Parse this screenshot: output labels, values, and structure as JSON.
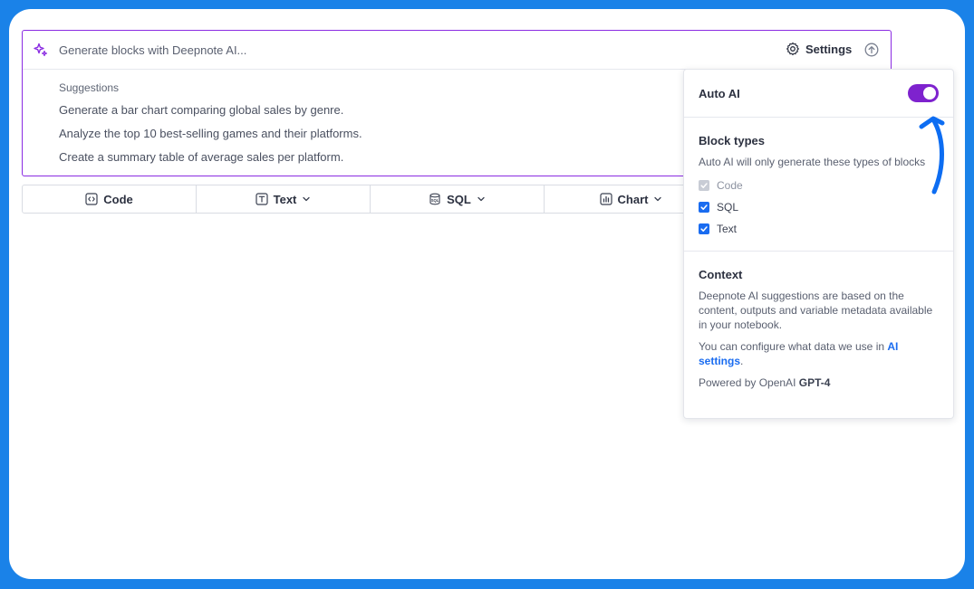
{
  "prompt": {
    "placeholder": "Generate blocks with Deepnote AI...",
    "settings_label": "Settings"
  },
  "suggestions": {
    "title": "Suggestions",
    "items": [
      "Generate a bar chart comparing global sales by genre.",
      "Analyze the top 10 best-selling games and their platforms.",
      "Create a summary table of average sales per platform."
    ]
  },
  "blocks": {
    "code": "Code",
    "text": "Text",
    "sql": "SQL",
    "chart": "Chart"
  },
  "panel": {
    "auto_ai_label": "Auto AI",
    "auto_ai_enabled": true,
    "block_types_title": "Block types",
    "block_types_desc": "Auto AI will only generate these types of blocks",
    "block_types": [
      {
        "label": "Code",
        "checked": true,
        "disabled": true
      },
      {
        "label": "SQL",
        "checked": true,
        "disabled": false
      },
      {
        "label": "Text",
        "checked": true,
        "disabled": false
      }
    ],
    "context_title": "Context",
    "context_desc": "Deepnote AI suggestions are based on the content, outputs and variable metadata available in your notebook.",
    "configure_prefix": "You can configure what data we use in ",
    "configure_link": "AI settings",
    "configure_suffix": ".",
    "powered_prefix": "Powered by OpenAI ",
    "powered_model": "GPT-4"
  },
  "colors": {
    "background": "#1a82e8",
    "accent_purple": "#7e22ce",
    "checkbox_blue": "#1a6cf0",
    "annotation_arrow": "#0d6df2"
  }
}
